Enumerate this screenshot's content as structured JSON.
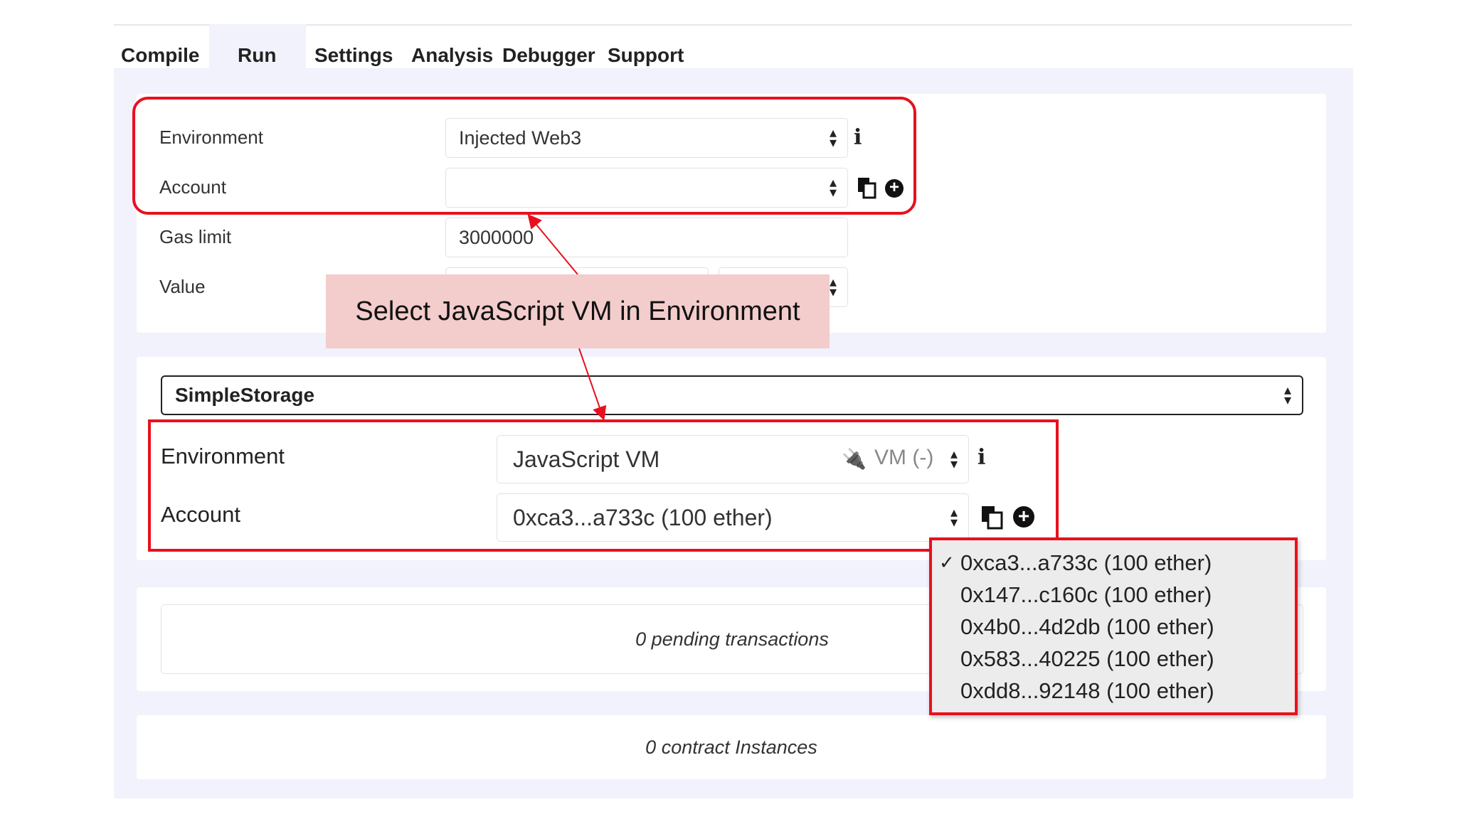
{
  "tabs": [
    {
      "label": "Compile"
    },
    {
      "label": "Run",
      "active": true
    },
    {
      "label": "Settings"
    },
    {
      "label": "Analysis"
    },
    {
      "label": "Debugger"
    },
    {
      "label": "Support"
    }
  ],
  "top_form": {
    "environment_label": "Environment",
    "environment_value": "Injected Web3",
    "account_label": "Account",
    "account_value": "",
    "gas_limit_label": "Gas limit",
    "gas_limit_value": "3000000",
    "value_label": "Value"
  },
  "callout": {
    "text": "Select JavaScript VM in Environment",
    "bg_color": "#f3cccc"
  },
  "contract": {
    "selected": "SimpleStorage"
  },
  "zoom_form": {
    "environment_label": "Environment",
    "environment_value": "JavaScript VM",
    "environment_badge": "VM (-)",
    "account_label": "Account",
    "account_value": "0xca3...a733c (100 ether)"
  },
  "account_dropdown": {
    "options": [
      {
        "label": "0xca3...a733c (100 ether)",
        "selected": true
      },
      {
        "label": "0x147...c160c (100 ether)",
        "selected": false
      },
      {
        "label": "0x4b0...4d2db (100 ether)",
        "selected": false
      },
      {
        "label": "0x583...40225 (100 ether)",
        "selected": false
      },
      {
        "label": "0xdd8...92148 (100 ether)",
        "selected": false
      }
    ],
    "check_mark": "✓"
  },
  "pending": {
    "text": "0 pending transactions"
  },
  "instances": {
    "text": "0 contract Instances"
  },
  "icons": {
    "info": "info-icon",
    "copy": "clipboard-icon",
    "add": "plus-circle-icon",
    "plug": "plug-icon",
    "arrows": "select-arrows-icon"
  },
  "colors": {
    "highlight": "#e8101e",
    "panel": "#f1f2fb",
    "callout": "#f3cccc"
  }
}
